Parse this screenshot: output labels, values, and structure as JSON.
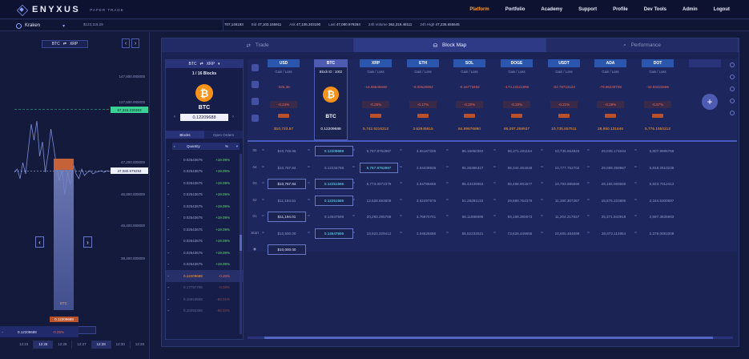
{
  "brand": {
    "name": "ENYXUS",
    "sub": "PAPER TRADE"
  },
  "nav": [
    "Platform",
    "Portfolio",
    "Academy",
    "Support",
    "Profile",
    "Dev Tools",
    "Admin",
    "Logout"
  ],
  "nav_active": "Platform",
  "ticker": {
    "exchange": "Kraken",
    "exchange_price": "$123,118.28",
    "items": [
      {
        "label": "",
        "value": "707,146193"
      },
      {
        "label": "Bid",
        "value": "47,103.155911"
      },
      {
        "label": "Ask",
        "value": "47,105.303190"
      },
      {
        "label": "Last",
        "value": "47,080.979284"
      },
      {
        "label": "24h Volume",
        "value": "362,319.48111"
      },
      {
        "label": "24h High",
        "value": "47,236.655645"
      }
    ]
  },
  "chart": {
    "pair_base": "BTC",
    "pair_quote": "XRP",
    "price_levels": [
      "147,800.000000",
      "127,600.000000",
      "47,200.000000",
      "46,800.000000",
      "46,400.000000",
      "39,400.000000"
    ],
    "tag_green": "67,315.230383",
    "tag_current": "47,080.979284",
    "col_label": "BTC",
    "value": "0.12209688",
    "blocks": "1 / 16 Blocks",
    "time_labels": [
      "12:23",
      "12:26",
      "12:28",
      "12:27",
      "12:28",
      "12:30",
      "12:28"
    ],
    "time_highlight": [
      1,
      4
    ]
  },
  "sidebar_icons": [
    "wallet-icon",
    "chart-line-icon",
    "list-icon",
    "bar-chart-icon",
    "expand-icon",
    "pulse-icon",
    "grid-icon",
    "code-icon"
  ],
  "tabs": [
    {
      "label": "Trade",
      "icon": "swap-icon"
    },
    {
      "label": "Block Map",
      "icon": "blocks-icon"
    },
    {
      "label": "Performance",
      "icon": "search-icon"
    }
  ],
  "tab_active": "Block Map",
  "pair_card": {
    "base": "BTC",
    "quote": "XRP",
    "blocks": "1 / 16 Blocks",
    "coin": "BTC",
    "value": "0.12209688",
    "subtabs": [
      "Blocks",
      "Open Orders"
    ],
    "qty_head": "Quantity",
    "qty_unit": "%",
    "rows": [
      {
        "q": "0.02543675",
        "p": "+19.09%",
        "neg": false
      },
      {
        "q": "0.02543675",
        "p": "+19.09%",
        "neg": false
      },
      {
        "q": "0.02543675",
        "p": "+19.09%",
        "neg": false
      },
      {
        "q": "0.02543675",
        "p": "+19.09%",
        "neg": false
      },
      {
        "q": "0.02543675",
        "p": "+19.09%",
        "neg": false
      },
      {
        "q": "0.02543675",
        "p": "+19.09%",
        "neg": false
      },
      {
        "q": "0.02543675",
        "p": "+19.09%",
        "neg": false
      },
      {
        "q": "0.02543675",
        "p": "+19.09%",
        "neg": false
      },
      {
        "q": "0.02543675",
        "p": "+19.09%",
        "neg": false
      },
      {
        "q": "0.02543675",
        "p": "+19.09%",
        "neg": false
      },
      {
        "q": "0.12209688",
        "p": "-0.25%",
        "neg": true,
        "active": true
      },
      {
        "q": "0.17797765",
        "p": "-0.00%",
        "neg": true,
        "muted": true
      },
      {
        "q": "0.16943568",
        "p": "-94.01%",
        "neg": true,
        "muted": true
      },
      {
        "q": "0.15092398",
        "p": "-98.02%",
        "neg": true,
        "muted": true
      }
    ],
    "total_q": "0.12209688",
    "total_p": "-0.25%"
  },
  "grid": {
    "columns": [
      {
        "name": "USD",
        "pnl": "-325.30",
        "pct": "-0.24%",
        "val": "$10,723.57"
      },
      {
        "name": "BTC",
        "pnl": "",
        "pct": "",
        "val": "0.12209688",
        "block": "Block ID : 1002"
      },
      {
        "name": "XRP",
        "pnl": "-14.55646848",
        "pct": "-0.25%",
        "val": "5,742.5216312"
      },
      {
        "name": "ETH",
        "pnl": "-0.00626962",
        "pct": "-0.17%",
        "val": "3.62945815"
      },
      {
        "name": "SOL",
        "pnl": "-0.16773492",
        "pct": "-0.20%",
        "val": "84.99876890"
      },
      {
        "name": "DOGE",
        "pnl": "-174.13121996",
        "pct": "-0.20%",
        "val": "86,097.269937"
      },
      {
        "name": "USDT",
        "pnl": "-22.79723123",
        "pct": "-0.21%",
        "val": "10,735.857511"
      },
      {
        "name": "ADA",
        "pnl": "-79.96239728",
        "pct": "-0.28%",
        "val": "28,950.131646"
      },
      {
        "name": "DOT",
        "pnl": "-32.83422665",
        "pct": "-0.57%",
        "val": "5,775.1650312"
      }
    ],
    "gain_loss": "Gain / Loss",
    "blocks": [
      {
        "label": "05",
        "cells": [
          "$10,748.86",
          "0.12209689",
          "5,767.8762997",
          "3.65167206",
          "85.16650392",
          "86,271.401154",
          "10,735.654823",
          "29,035.174044",
          "5,807.9995769"
        ]
      },
      {
        "label": "04",
        "cells": [
          "$10,767.84",
          "0.12234788",
          "5,757.8762997",
          "3.64439935",
          "85.26366427",
          "86,344.461648",
          "10,777.752702",
          "29,089.358967",
          "5,818.2510239"
        ]
      },
      {
        "label": "03",
        "cells": [
          "$10,767.84",
          "0.12251595",
          "5,773.0072379",
          "3.64785665",
          "85.43439683",
          "86,468.901577",
          "10,793.885590",
          "29,155.068566",
          "5,823.7012413"
        ]
      },
      {
        "label": "02",
        "cells": [
          "$11,184.51",
          "0.12251595",
          "12,528.693809",
          "3.62497976",
          "51.26281133",
          "29,699.754379",
          "11,190.307267",
          "15,576.223886",
          "2,164.5300697"
        ]
      },
      {
        "label": "01",
        "cells": [
          "$11,194.01",
          "0.14647598",
          "20,293.295788",
          "3.76970701",
          "56.11886998",
          "59,169.380073",
          "11,204.217837",
          "25,371.943918",
          "2,597.3835993"
        ]
      },
      {
        "label": "Start",
        "cells": [
          "$10,500.00",
          "0.14647995",
          "18,923.329412",
          "3.94526686",
          "55.52233021",
          "73,629.449655",
          "10,605.484099",
          "28,872.113984",
          "2,378.0081008"
        ]
      },
      {
        "label": "",
        "cells": [
          "$10,000.00",
          "",
          "",
          "",
          "",
          "",
          "",
          "",
          ""
        ]
      }
    ]
  }
}
